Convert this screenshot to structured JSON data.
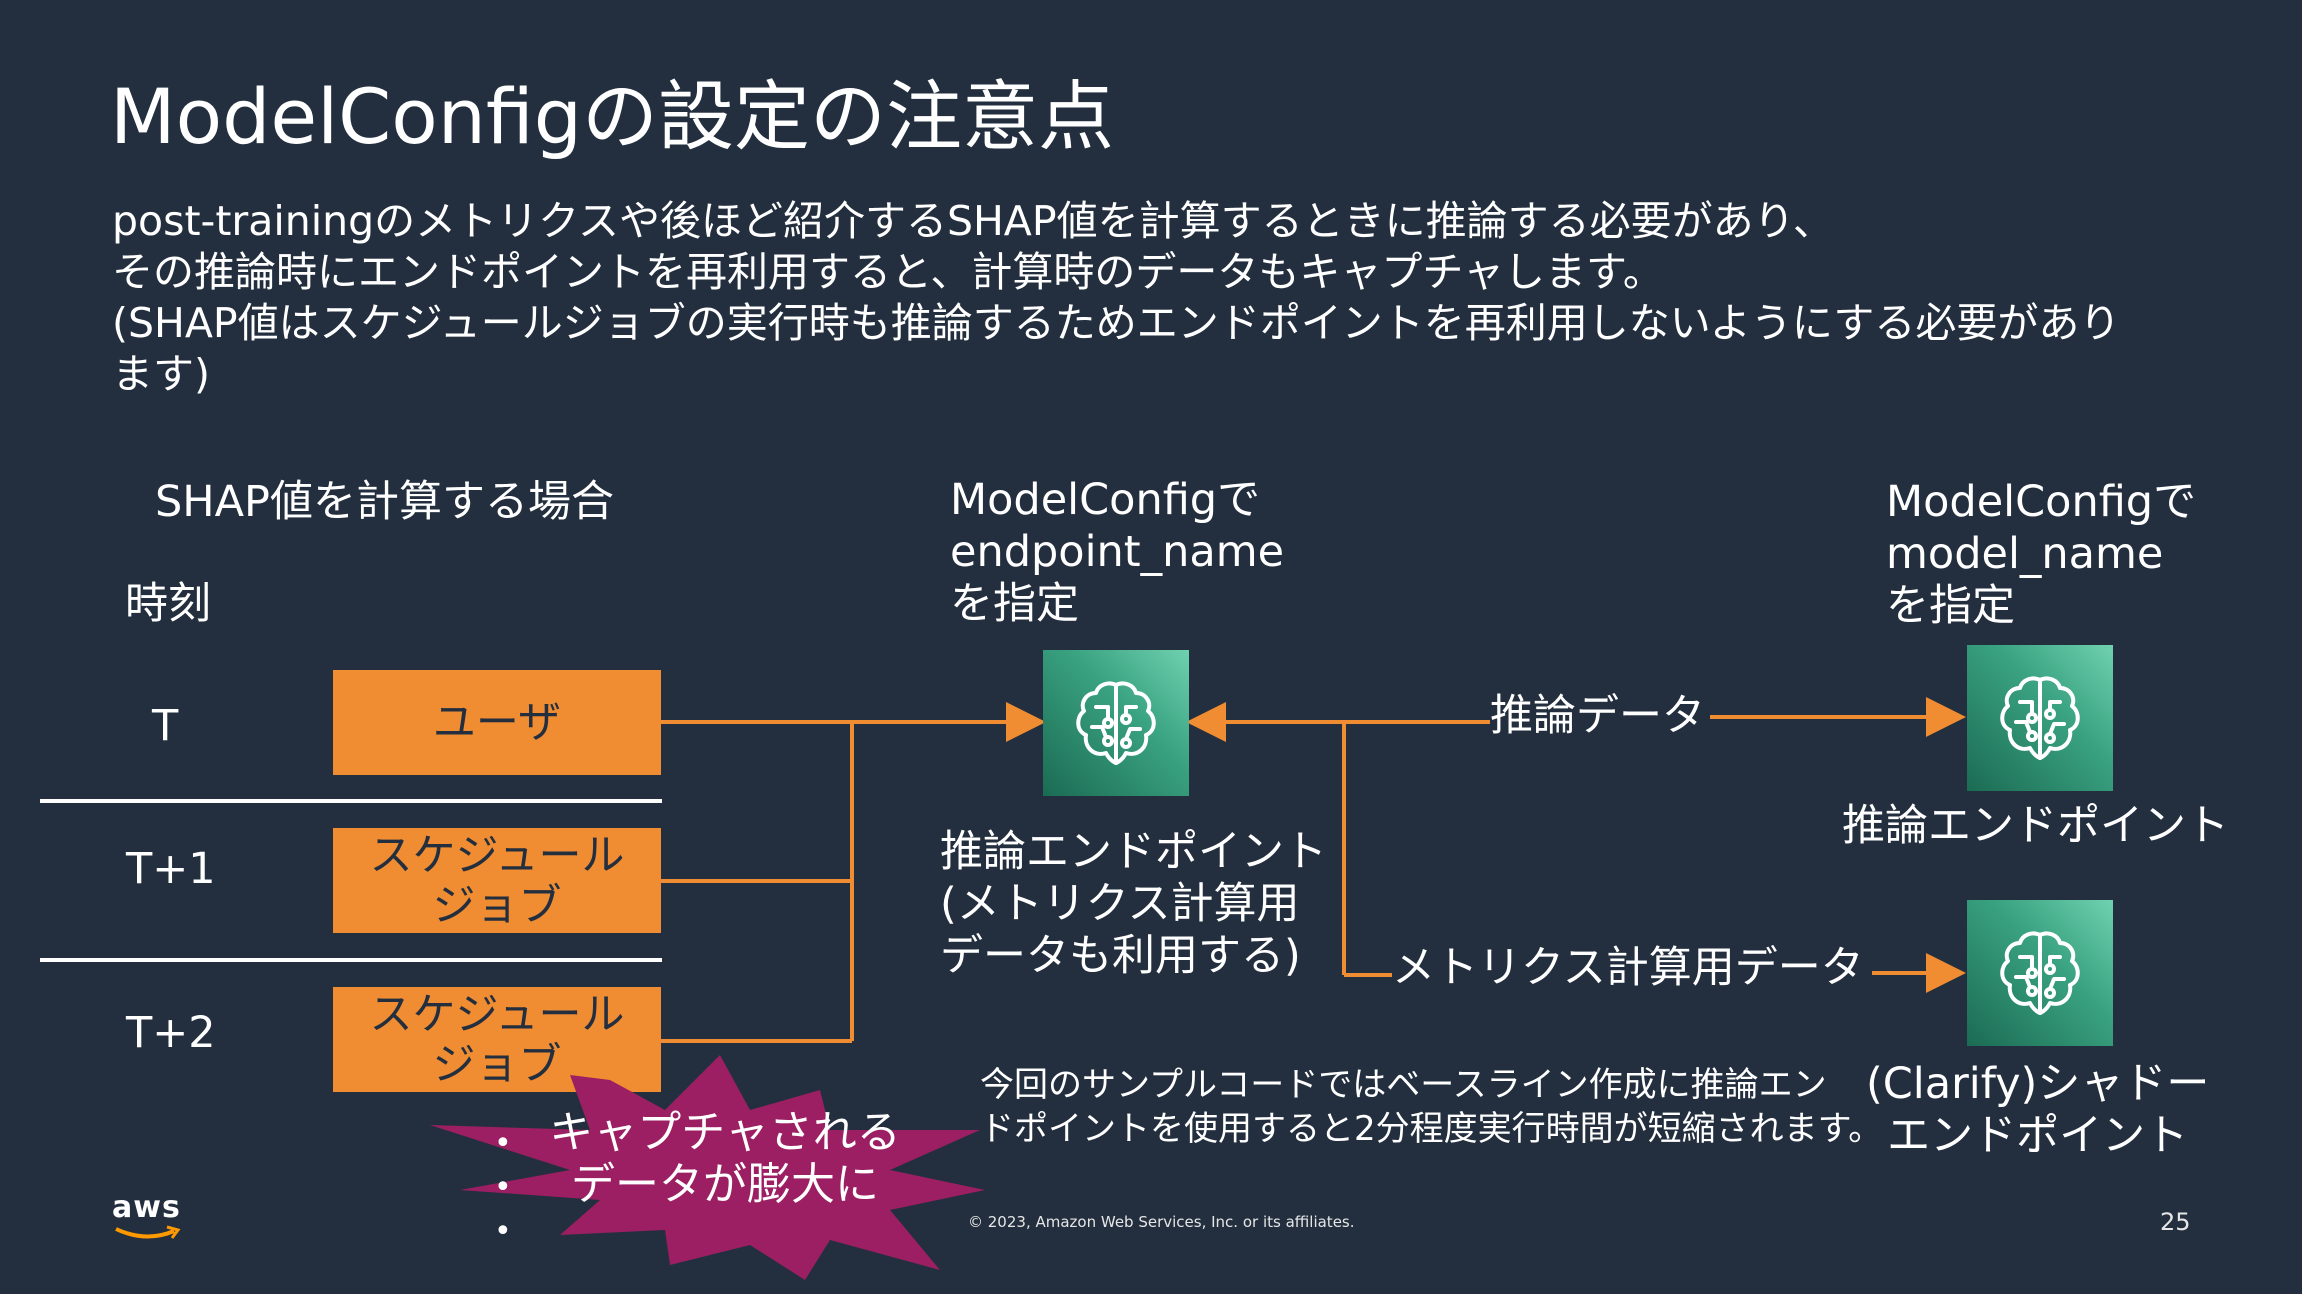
{
  "title": "ModelConfigの設定の注意点",
  "body_lines": [
    "post-trainingのメトリクスや後ほど紹介するSHAP値を計算するときに推論する必要があり、",
    "その推論時にエンドポイントを再利用すると、計算時のデータもキャプチャします。",
    "(SHAP値はスケジュールジョブの実行時も推論するためエンドポイントを再利用しないようにする必要があり",
    "ます)"
  ],
  "diagram": {
    "heading": "SHAP値を計算する場合",
    "time_header": "時刻",
    "times": [
      "T",
      "T+1",
      "T+2"
    ],
    "boxes": [
      {
        "lines": [
          "ユーザ"
        ]
      },
      {
        "lines": [
          "スケジュール",
          "ジョブ"
        ]
      },
      {
        "lines": [
          "スケジュール",
          "ジョブ"
        ]
      }
    ],
    "endpoint_config_label": [
      "ModelConfigで",
      "endpoint_name",
      "を指定"
    ],
    "model_config_label": [
      "ModelConfigで",
      "model_name",
      "を指定"
    ],
    "center_endpoint_label": [
      "推論エンドポイント",
      "(メトリクス計算用",
      "データも利用する)"
    ],
    "right_endpoint_label": "推論エンドポイント",
    "shadow_endpoint_label": [
      "(Clarify)シャドー",
      "エンドポイント"
    ],
    "arrow_inference": "推論データ",
    "arrow_metrics": "メトリクス計算用データ",
    "note_lines": [
      "今回のサンプルコードではベースライン作成に推論エン",
      "ドポイントを使用すると2分程度実行時間が短縮されます。"
    ],
    "burst_lines": [
      "キャプチャされる",
      "データが膨大に"
    ],
    "icon_name": "sagemaker-brain-icon"
  },
  "footer": {
    "logo": "aws",
    "copyright": "© 2023, Amazon Web Services, Inc. or its affiliates.",
    "page_number": "25"
  },
  "colors": {
    "background": "#232f3e",
    "orange": "#f08c32",
    "burst": "#9b1f62",
    "icon_green": "#3aa381"
  }
}
